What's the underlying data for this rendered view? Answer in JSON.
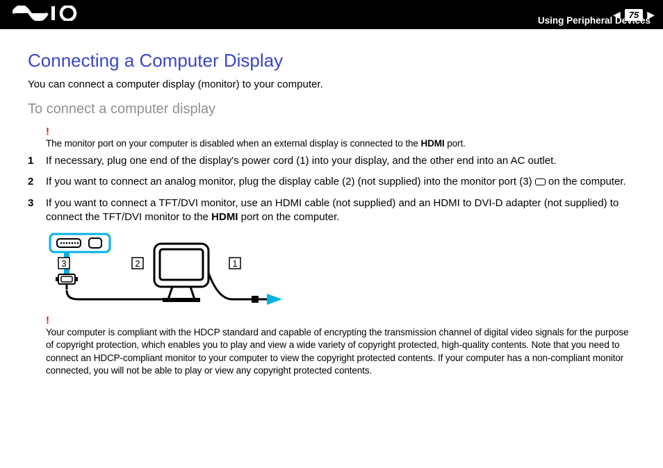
{
  "header": {
    "page_number": "75",
    "breadcrumb": "Using Peripheral Devices"
  },
  "title": "Connecting a Computer Display",
  "lead": "You can connect a computer display (monitor) to your computer.",
  "subheading": "To connect a computer display",
  "warning1": {
    "bang": "!",
    "text_before": "The monitor port on your computer is disabled when an external display is connected to the ",
    "bold1": "HDMI",
    "text_after": " port."
  },
  "steps": [
    {
      "num": "1",
      "text": "If necessary, plug one end of the display's power cord (1) into your display, and the other end into an AC outlet."
    },
    {
      "num": "2",
      "text_before": "If you want to connect an analog monitor, plug the display cable (2) (not supplied) into the monitor port (3) ",
      "text_after": " on the computer."
    },
    {
      "num": "3",
      "text_before": "If you want to connect a TFT/DVI monitor, use an HDMI cable (not supplied) and an HDMI to DVI-D adapter (not supplied) to connect the TFT/DVI monitor to the ",
      "bold1": "HDMI",
      "text_after": " port on the computer."
    }
  ],
  "diagram": {
    "labels": {
      "l1": "1",
      "l2": "2",
      "l3": "3"
    }
  },
  "warning2": {
    "bang": "!",
    "text": "Your computer is compliant with the HDCP standard and capable of encrypting the transmission channel of digital video signals for the purpose of copyright protection, which enables you to play and view a wide variety of copyright protected, high-quality contents. Note that you need to connect an HDCP-compliant monitor to your computer to view the copyright protected contents. If your computer has a non-compliant monitor connected, you will not be able to play or view any copyright protected contents."
  }
}
